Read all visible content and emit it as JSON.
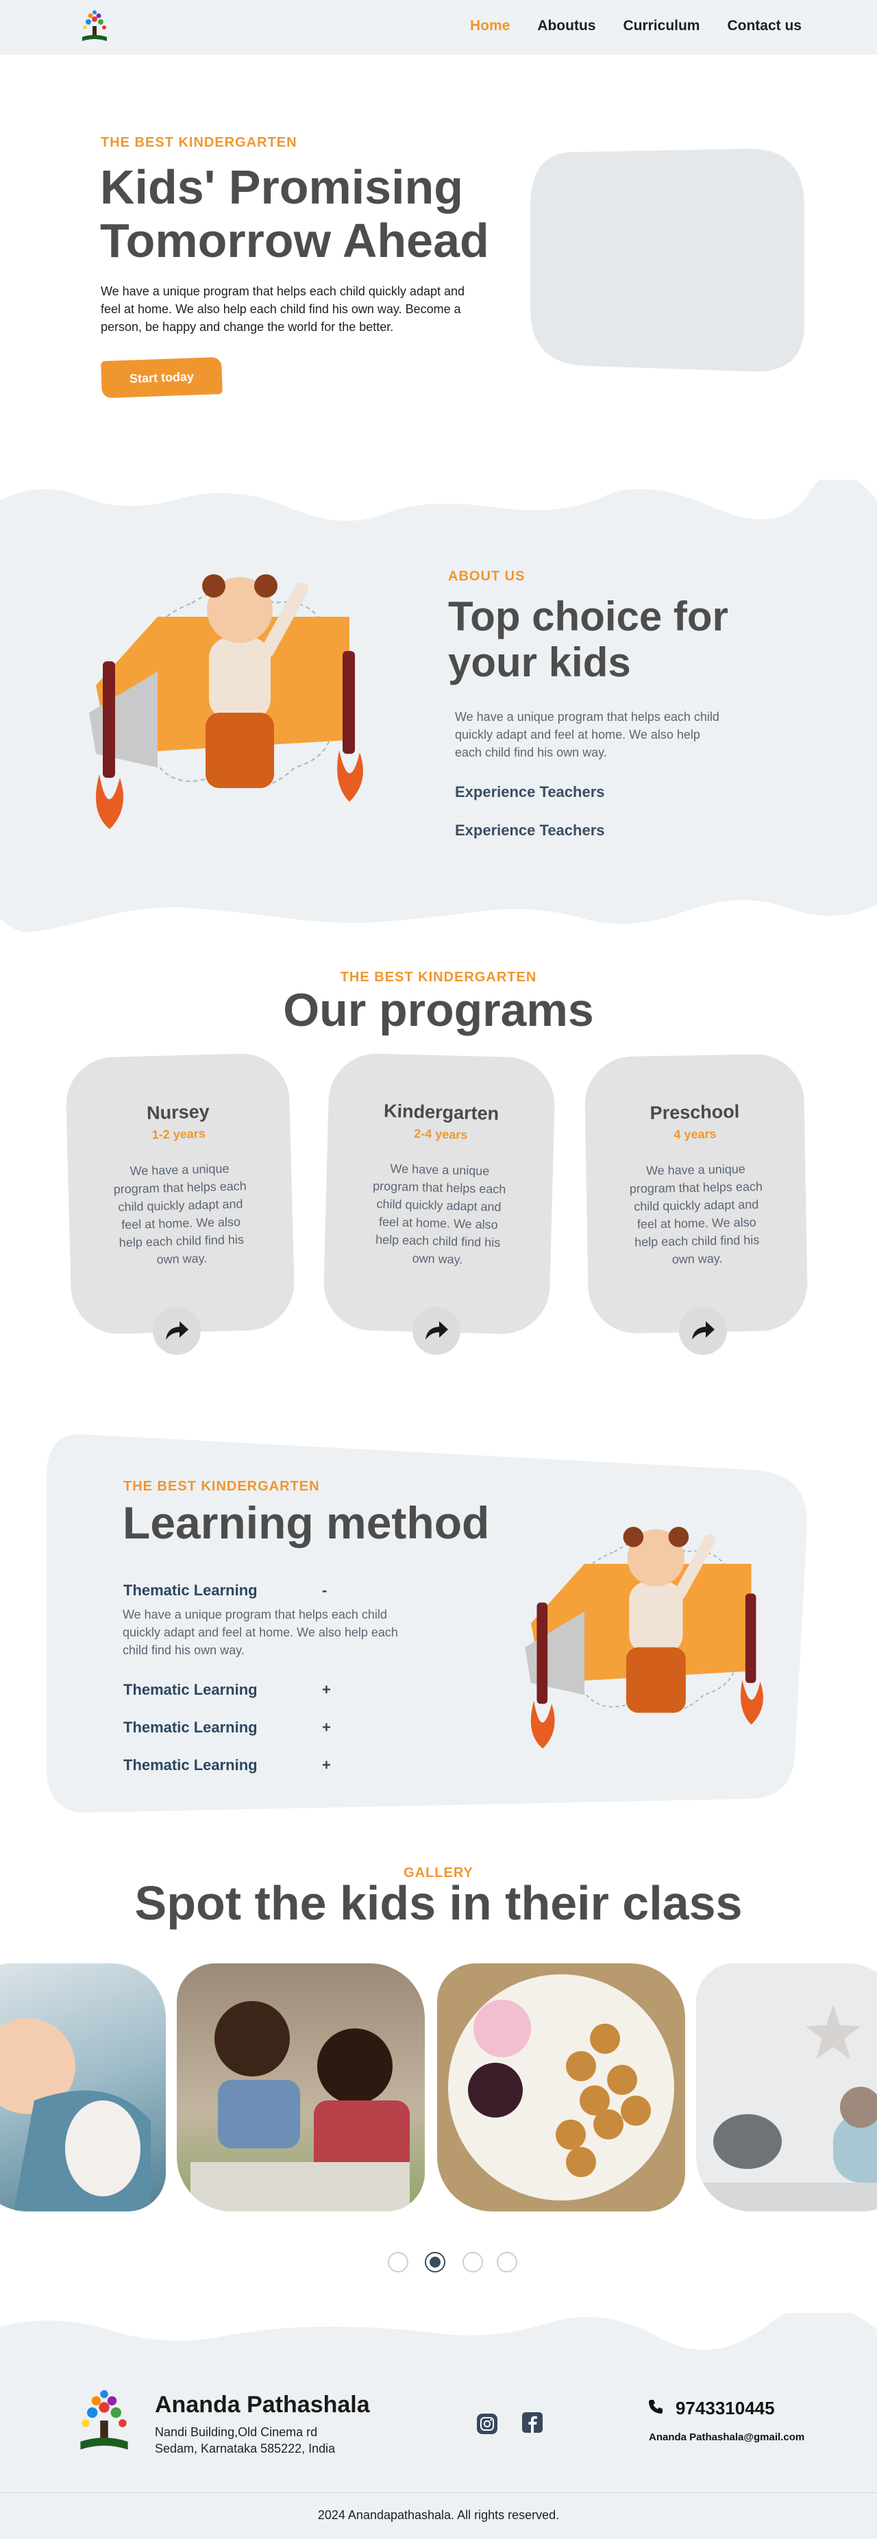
{
  "nav": {
    "items": [
      "Home",
      "Aboutus",
      "Curriculum",
      "Contact us"
    ],
    "active_index": 0
  },
  "hero": {
    "eyebrow": "THE BEST KINDERGARTEN",
    "title_line1": "Kids' Promising",
    "title_line2": "Tomorrow Ahead",
    "paragraph": "We have a unique program that helps each child quickly adapt and feel at home. We also help each child find his own way. Become a person, be happy and change the world for the better.",
    "cta": "Start today"
  },
  "about": {
    "eyebrow": "ABOUT US",
    "title_line1": "Top choice for",
    "title_line2": "your kids",
    "paragraph": "We have a unique program that helps each child quickly adapt and feel at home. We also help each child find his own way.",
    "features": [
      "Experience Teachers",
      "Experience Teachers"
    ]
  },
  "programs": {
    "eyebrow": "THE BEST KINDERGARTEN",
    "title": "Our programs",
    "cards": [
      {
        "title": "Nursey",
        "age": "1-2 years",
        "text": "We have a unique program that helps each child quickly adapt and feel at home. We also help each child find his own way."
      },
      {
        "title": "Kindergarten",
        "age": "2-4 years",
        "text": "We have a unique program that helps each child quickly adapt and feel at home. We also help each child find his own way."
      },
      {
        "title": "Preschool",
        "age": "4 years",
        "text": "We have a unique program that helps each child quickly adapt and feel at home. We also help each child find his own way."
      }
    ]
  },
  "learning": {
    "eyebrow": "THE BEST KINDERGARTEN",
    "title": "Learning method",
    "items": [
      {
        "title": "Thematic Learning",
        "toggle": "-",
        "text": "We have a unique program that helps each child quickly adapt and feel at home. We also help each child find his own way."
      },
      {
        "title": "Thematic Learning",
        "toggle": "+"
      },
      {
        "title": "Thematic Learning",
        "toggle": "+"
      },
      {
        "title": "Thematic Learning",
        "toggle": "+"
      }
    ]
  },
  "gallery": {
    "eyebrow": "GALLERY",
    "title": "Spot the kids in their class",
    "slide_count": 4,
    "active_slide": 1
  },
  "footer": {
    "brand": "Ananda Pathashala",
    "address_line1": "Nandi Building,Old Cinema rd",
    "address_line2": "Sedam, Karnataka 585222, India",
    "phone": "9743310445",
    "email": "Ananda Pathashala@gmail.com",
    "copyright": "2024 Anandapathashala. All rights reserved."
  },
  "colors": {
    "accent": "#f0962f",
    "heading": "#4d4d4d",
    "section_bg": "#edf1f3",
    "dark_blue": "#2d4660"
  },
  "icons": [
    "tree-logo-icon",
    "curved-arrow-icon",
    "instagram-icon",
    "facebook-icon",
    "phone-icon"
  ]
}
